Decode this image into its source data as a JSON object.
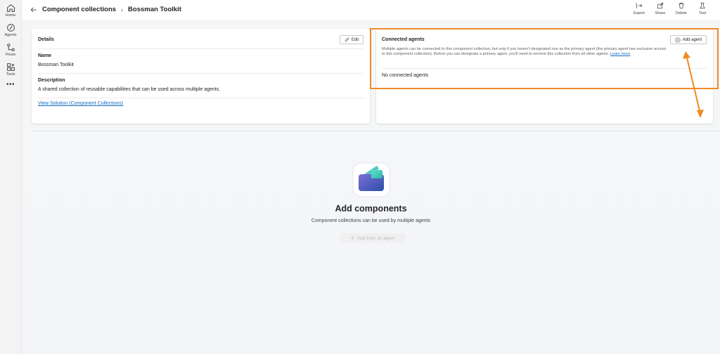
{
  "rail": {
    "items": [
      {
        "label": "Home",
        "icon": "home-icon"
      },
      {
        "label": "Agents",
        "icon": "agents-icon"
      },
      {
        "label": "Flows",
        "icon": "flows-icon"
      },
      {
        "label": "Tools",
        "icon": "tools-icon"
      }
    ],
    "more": "•••"
  },
  "header": {
    "breadcrumb_parent": "Component collections",
    "breadcrumb_current": "Bossman Toolkit",
    "actions": [
      {
        "label": "Export",
        "icon": "export-icon"
      },
      {
        "label": "Share",
        "icon": "share-icon"
      },
      {
        "label": "Delete",
        "icon": "delete-icon"
      },
      {
        "label": "Test",
        "icon": "test-icon"
      }
    ]
  },
  "details": {
    "title": "Details",
    "edit_label": "Edit",
    "name_label": "Name",
    "name_value": "Bossman Toolkit",
    "description_label": "Description",
    "description_value": "A shared collection of reusable capabilities that can be used across multiple agents.",
    "solution_link": "View Solution (Component Collections)"
  },
  "connected": {
    "title": "Connected agents",
    "add_label": "Add agent",
    "description": "Multiple agents can be connected to this component collection, but only if you haven't designated one as the primary agent (the primary agent has exclusive access to this component collection). Before you can designate a primary agent, you'll need to remove this collection from all other agents.",
    "learn_more": "Learn more",
    "empty": "No connected agents"
  },
  "empty_state": {
    "title": "Add components",
    "subtitle": "Component collections can be used by multiple agents",
    "button_label": "Add from an agent"
  },
  "colors": {
    "accent": "#0f6cbd",
    "annotation": "#f08a24"
  }
}
